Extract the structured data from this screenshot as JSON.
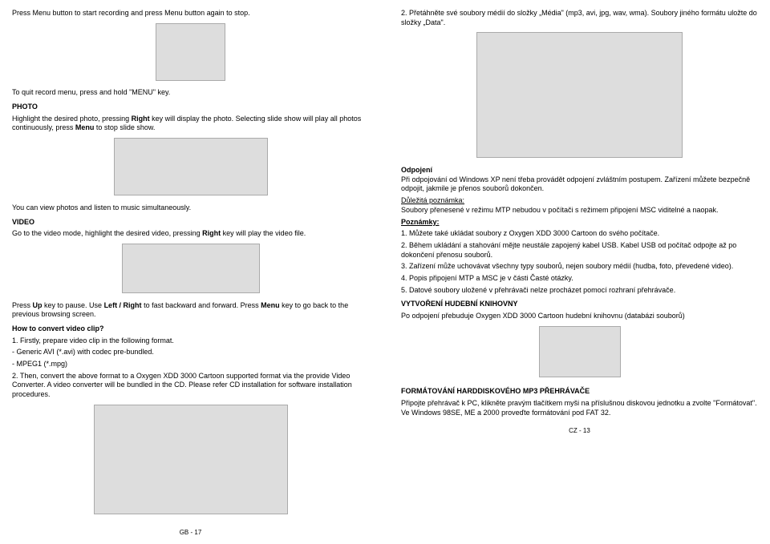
{
  "left": {
    "intro": "Press Menu button to start recording and press Menu button again to stop.",
    "quit": "To quit record menu, press and hold \"MENU\" key.",
    "photo_head": "PHOTO",
    "photo_p1a": "Highlight the desired photo, pressing ",
    "photo_p1b": "Right",
    "photo_p1c": " key will display the photo. Selecting slide show will play all photos continuously, press ",
    "photo_p1d": "Menu",
    "photo_p1e": " to stop slide show.",
    "photo_p2": "You can view photos and listen to music simultaneously.",
    "video_head": "VIDEO",
    "video_p1a": "Go to the video mode, highlight the desired video, pressing ",
    "video_p1b": "Right",
    "video_p1c": " key will play the video file.",
    "video_p2a": "Press ",
    "video_p2b": "Up",
    "video_p2c": " key to pause. Use ",
    "video_p2d": "Left / Right",
    "video_p2e": " to fast backward and forward. Press ",
    "video_p2f": "Menu",
    "video_p2g": " key to go back to the previous browsing screen.",
    "conv_head": "How to convert video clip?",
    "conv_l1": "1. Firstly, prepare video clip in the following format.",
    "conv_l2": "- Generic AVI (*.avi) with codec pre-bundled.",
    "conv_l3": "- MPEG1 (*.mpg)",
    "conv_l4": "2. Then, convert the above format to a Oxygen XDD 3000 Cartoon supported format via the provide Video Converter. A video converter will be bundled in the CD. Please refer CD installation for software installation procedures.",
    "footer": "GB - 17"
  },
  "right": {
    "p1": "2. Přetáhněte své soubory médií do složky „Média\" (mp3, avi, jpg, wav, wma). Soubory jiného formátu uložte do složky „Data\".",
    "odp_head": "Odpojení",
    "odp_p": "Při odpojování od Windows XP není třeba provádět odpojení zvláštním postupem. Zařízení můžete bezpečně odpojit, jakmile je přenos souborů dokončen.",
    "note_head": "Důležitá poznámka:",
    "note_p": "Soubory přenesené v režimu MTP nebudou v počítači s režimem připojení MSC viditelné a naopak.",
    "pozn_head": "Poznámky:",
    "pozn1": "1. Můžete také ukládat soubory z Oxygen XDD 3000 Cartoon do svého počítače.",
    "pozn2": "2. Během ukládání a stahování mějte neustále zapojený kabel USB. Kabel USB od počítač odpojte až po dokončení přenosu souborů.",
    "pozn3": "3. Zařízení může uchovávat všechny typy souborů, nejen soubory médií (hudba, foto, převedené video).",
    "pozn4": "4. Popis připojení MTP a MSC je v části Časté otázky.",
    "pozn5": "5. Datové soubory uložené v přehrávači nelze procházet pomocí rozhraní přehrávače.",
    "lib_head": "VYTVOŘENÍ HUDEBNÍ KNIHOVNY",
    "lib_p": "Po odpojení přebuduje Oxygen XDD 3000 Cartoon hudební knihovnu (databázi souborů)",
    "fmt_head": "FORMÁTOVÁNÍ HARDDISKOVÉHO MP3 PŘEHRÁVAČE",
    "fmt_p": "Připojte přehrávač k PC, klikněte pravým tlačítkem myši na příslušnou diskovou jednotku a zvolte \"Formátovat\". Ve Windows 98SE, ME a 2000 proveďte formátování pod FAT 32.",
    "footer": "CZ - 13"
  }
}
